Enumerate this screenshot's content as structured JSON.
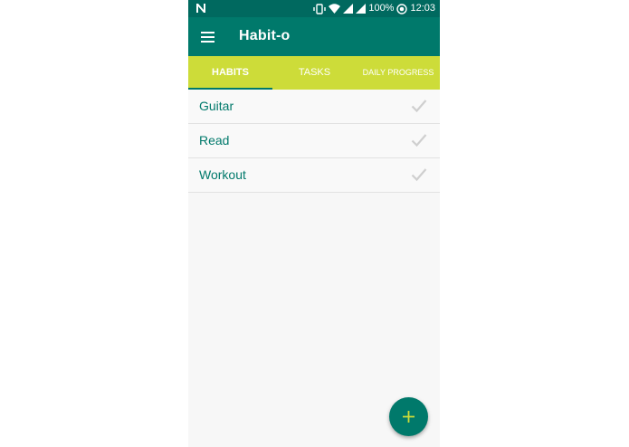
{
  "status_bar": {
    "battery_percent": "100%",
    "time": "12:03",
    "icons": [
      "nfc-icon",
      "vibrate-icon",
      "wifi-icon",
      "signal-icon",
      "signal-icon",
      "sync-icon"
    ]
  },
  "app_bar": {
    "title": "Habit-o",
    "menu_icon": "hamburger-menu-icon"
  },
  "tabs": [
    {
      "label": "HABITS",
      "selected": true
    },
    {
      "label": "TASKS",
      "selected": false
    },
    {
      "label": "DAILY PROGRESS",
      "selected": false
    }
  ],
  "habits": [
    {
      "label": "Guitar",
      "checked": false
    },
    {
      "label": "Read",
      "checked": false
    },
    {
      "label": "Workout",
      "checked": false
    }
  ],
  "fab": {
    "icon": "plus-icon"
  },
  "colors": {
    "primary": "#00796b",
    "primary_dark": "#00695f",
    "accent": "#cddc39",
    "check_inactive": "#cfcfcf",
    "background": "#f7f7f7"
  }
}
